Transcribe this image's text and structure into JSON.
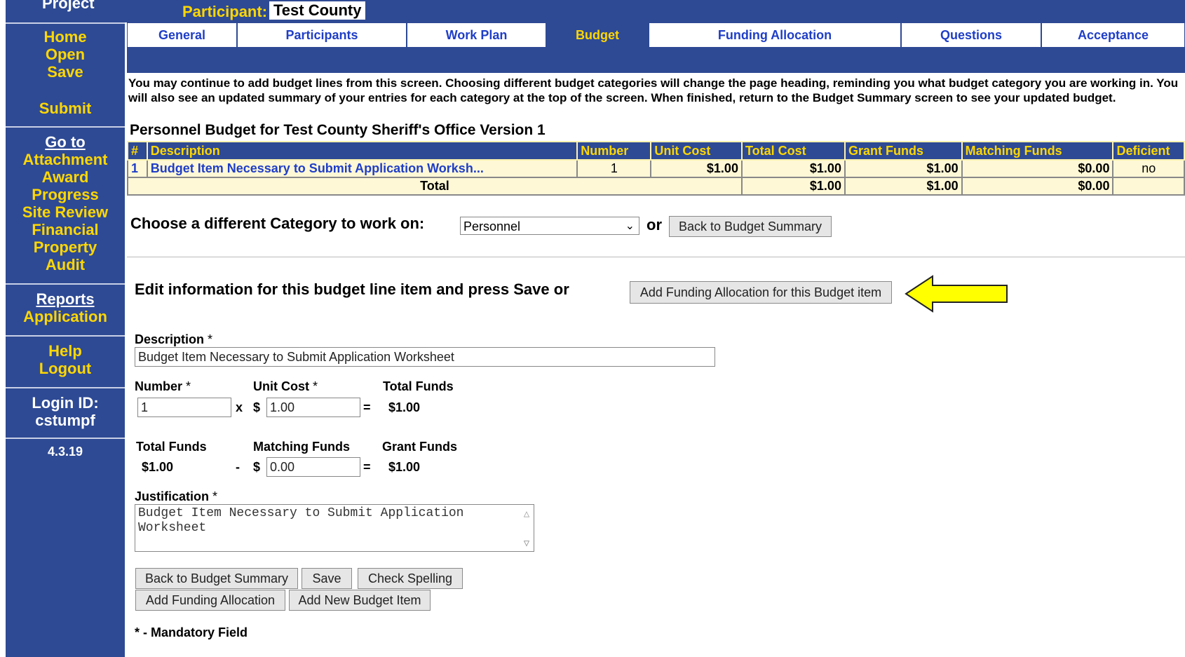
{
  "header": {
    "project_label": "Project",
    "participant_label": "Participant:",
    "participant_value": "Test County"
  },
  "sidebar": {
    "group1": [
      "Home",
      "Open",
      "Save"
    ],
    "submit": "Submit",
    "goto": "Go to",
    "group2": [
      "Attachment",
      "Award",
      "Progress",
      "Site Review",
      "Financial",
      "Property",
      "Audit"
    ],
    "reports": "Reports",
    "application": "Application",
    "help": "Help",
    "logout": "Logout",
    "login_label": "Login ID:",
    "login_id": "cstumpf",
    "version": "4.3.19"
  },
  "tabs": [
    "General",
    "Participants",
    "Work Plan",
    "Budget",
    "Funding Allocation",
    "Questions",
    "Acceptance"
  ],
  "active_tab": "Budget",
  "intro": "You may continue to add budget lines from this screen. Choosing different budget categories will change the page heading, reminding you what budget category you are working in. You will also see an updated summary of your entries for each category at the top of the screen. When finished, return to the Budget Summary screen to see your updated budget.",
  "section_title": "Personnel Budget for Test County Sheriff's Office Version 1",
  "table": {
    "headers": [
      "#",
      "Description",
      "Number",
      "Unit Cost",
      "Total Cost",
      "Grant Funds",
      "Matching Funds",
      "Deficient"
    ],
    "rows": [
      [
        "1",
        "Budget Item Necessary to Submit Application Worksh...",
        "1",
        "$1.00",
        "$1.00",
        "$1.00",
        "$0.00",
        "no"
      ]
    ],
    "total": {
      "label": "Total",
      "total_cost": "$1.00",
      "grant_funds": "$1.00",
      "matching_funds": "$0.00"
    }
  },
  "category": {
    "label": "Choose a different Category to work on:",
    "selected": "Personnel",
    "or": "or",
    "back_button": "Back to Budget Summary"
  },
  "edit": {
    "label": "Edit information for this budget line item and press Save or",
    "add_alloc_button": "Add Funding Allocation for this Budget item"
  },
  "form": {
    "description_label": "Description",
    "description_value": "Budget Item Necessary to Submit Application Worksheet",
    "number_label": "Number",
    "number_value": "1",
    "unit_cost_label": "Unit Cost",
    "unit_cost_value": "1.00",
    "total_funds_label": "Total Funds",
    "total_funds_value": "$1.00",
    "matching_label": "Matching Funds",
    "matching_value": "0.00",
    "grant_label": "Grant Funds",
    "grant_value": "$1.00",
    "justification_label": "Justification",
    "justification_value": "Budget Item Necessary to Submit Application Worksheet",
    "star": "*",
    "times": "x",
    "dollar": "$",
    "equals": "=",
    "minus": "-"
  },
  "buttons": {
    "back": "Back to Budget Summary",
    "save": "Save",
    "spell": "Check Spelling",
    "add_alloc": "Add Funding Allocation",
    "add_item": "Add New Budget Item"
  },
  "mandatory": "* - Mandatory Field",
  "colors": {
    "nav_bg": "#2e4a94",
    "nav_text": "#ffd700",
    "tab_text": "#1f3ec7",
    "arrow": "#ffff00"
  }
}
